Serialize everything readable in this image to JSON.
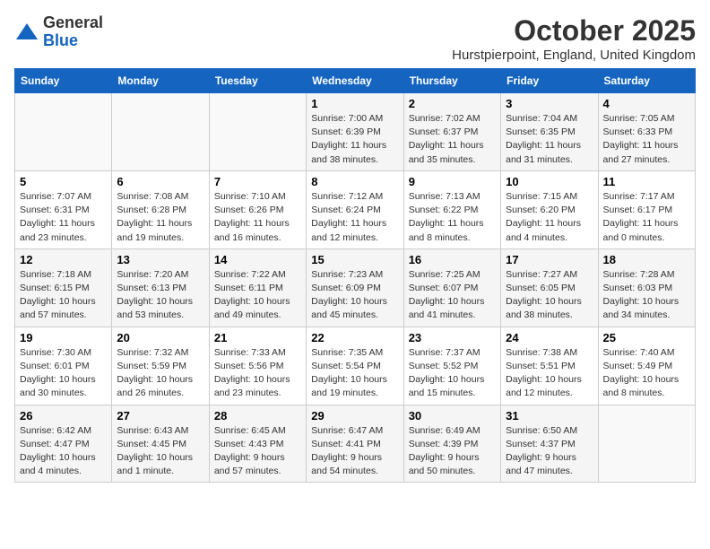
{
  "logo": {
    "line1": "General",
    "line2": "Blue"
  },
  "title": "October 2025",
  "location": "Hurstpierpoint, England, United Kingdom",
  "days_of_week": [
    "Sunday",
    "Monday",
    "Tuesday",
    "Wednesday",
    "Thursday",
    "Friday",
    "Saturday"
  ],
  "weeks": [
    [
      {
        "day": "",
        "info": ""
      },
      {
        "day": "",
        "info": ""
      },
      {
        "day": "",
        "info": ""
      },
      {
        "day": "1",
        "info": "Sunrise: 7:00 AM\nSunset: 6:39 PM\nDaylight: 11 hours\nand 38 minutes."
      },
      {
        "day": "2",
        "info": "Sunrise: 7:02 AM\nSunset: 6:37 PM\nDaylight: 11 hours\nand 35 minutes."
      },
      {
        "day": "3",
        "info": "Sunrise: 7:04 AM\nSunset: 6:35 PM\nDaylight: 11 hours\nand 31 minutes."
      },
      {
        "day": "4",
        "info": "Sunrise: 7:05 AM\nSunset: 6:33 PM\nDaylight: 11 hours\nand 27 minutes."
      }
    ],
    [
      {
        "day": "5",
        "info": "Sunrise: 7:07 AM\nSunset: 6:31 PM\nDaylight: 11 hours\nand 23 minutes."
      },
      {
        "day": "6",
        "info": "Sunrise: 7:08 AM\nSunset: 6:28 PM\nDaylight: 11 hours\nand 19 minutes."
      },
      {
        "day": "7",
        "info": "Sunrise: 7:10 AM\nSunset: 6:26 PM\nDaylight: 11 hours\nand 16 minutes."
      },
      {
        "day": "8",
        "info": "Sunrise: 7:12 AM\nSunset: 6:24 PM\nDaylight: 11 hours\nand 12 minutes."
      },
      {
        "day": "9",
        "info": "Sunrise: 7:13 AM\nSunset: 6:22 PM\nDaylight: 11 hours\nand 8 minutes."
      },
      {
        "day": "10",
        "info": "Sunrise: 7:15 AM\nSunset: 6:20 PM\nDaylight: 11 hours\nand 4 minutes."
      },
      {
        "day": "11",
        "info": "Sunrise: 7:17 AM\nSunset: 6:17 PM\nDaylight: 11 hours\nand 0 minutes."
      }
    ],
    [
      {
        "day": "12",
        "info": "Sunrise: 7:18 AM\nSunset: 6:15 PM\nDaylight: 10 hours\nand 57 minutes."
      },
      {
        "day": "13",
        "info": "Sunrise: 7:20 AM\nSunset: 6:13 PM\nDaylight: 10 hours\nand 53 minutes."
      },
      {
        "day": "14",
        "info": "Sunrise: 7:22 AM\nSunset: 6:11 PM\nDaylight: 10 hours\nand 49 minutes."
      },
      {
        "day": "15",
        "info": "Sunrise: 7:23 AM\nSunset: 6:09 PM\nDaylight: 10 hours\nand 45 minutes."
      },
      {
        "day": "16",
        "info": "Sunrise: 7:25 AM\nSunset: 6:07 PM\nDaylight: 10 hours\nand 41 minutes."
      },
      {
        "day": "17",
        "info": "Sunrise: 7:27 AM\nSunset: 6:05 PM\nDaylight: 10 hours\nand 38 minutes."
      },
      {
        "day": "18",
        "info": "Sunrise: 7:28 AM\nSunset: 6:03 PM\nDaylight: 10 hours\nand 34 minutes."
      }
    ],
    [
      {
        "day": "19",
        "info": "Sunrise: 7:30 AM\nSunset: 6:01 PM\nDaylight: 10 hours\nand 30 minutes."
      },
      {
        "day": "20",
        "info": "Sunrise: 7:32 AM\nSunset: 5:59 PM\nDaylight: 10 hours\nand 26 minutes."
      },
      {
        "day": "21",
        "info": "Sunrise: 7:33 AM\nSunset: 5:56 PM\nDaylight: 10 hours\nand 23 minutes."
      },
      {
        "day": "22",
        "info": "Sunrise: 7:35 AM\nSunset: 5:54 PM\nDaylight: 10 hours\nand 19 minutes."
      },
      {
        "day": "23",
        "info": "Sunrise: 7:37 AM\nSunset: 5:52 PM\nDaylight: 10 hours\nand 15 minutes."
      },
      {
        "day": "24",
        "info": "Sunrise: 7:38 AM\nSunset: 5:51 PM\nDaylight: 10 hours\nand 12 minutes."
      },
      {
        "day": "25",
        "info": "Sunrise: 7:40 AM\nSunset: 5:49 PM\nDaylight: 10 hours\nand 8 minutes."
      }
    ],
    [
      {
        "day": "26",
        "info": "Sunrise: 6:42 AM\nSunset: 4:47 PM\nDaylight: 10 hours\nand 4 minutes."
      },
      {
        "day": "27",
        "info": "Sunrise: 6:43 AM\nSunset: 4:45 PM\nDaylight: 10 hours\nand 1 minute."
      },
      {
        "day": "28",
        "info": "Sunrise: 6:45 AM\nSunset: 4:43 PM\nDaylight: 9 hours\nand 57 minutes."
      },
      {
        "day": "29",
        "info": "Sunrise: 6:47 AM\nSunset: 4:41 PM\nDaylight: 9 hours\nand 54 minutes."
      },
      {
        "day": "30",
        "info": "Sunrise: 6:49 AM\nSunset: 4:39 PM\nDaylight: 9 hours\nand 50 minutes."
      },
      {
        "day": "31",
        "info": "Sunrise: 6:50 AM\nSunset: 4:37 PM\nDaylight: 9 hours\nand 47 minutes."
      },
      {
        "day": "",
        "info": ""
      }
    ]
  ]
}
